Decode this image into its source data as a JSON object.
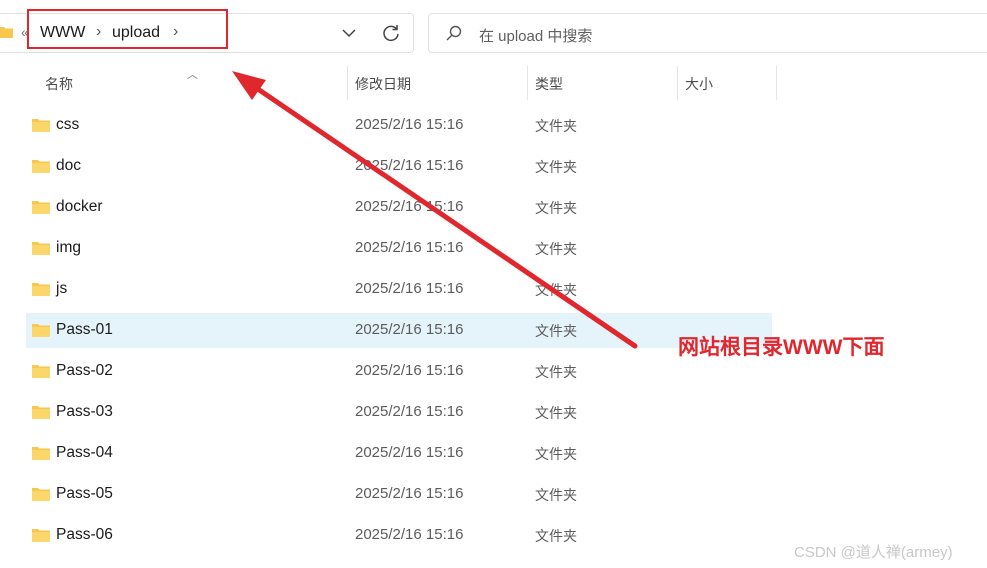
{
  "address_bar": {
    "overflow_glyph": "«",
    "crumbs": [
      "WWW",
      "upload"
    ],
    "separator": "›"
  },
  "search": {
    "placeholder": "在 upload 中搜索"
  },
  "columns": {
    "name": "名称",
    "modified": "修改日期",
    "type": "类型",
    "size": "大小"
  },
  "files": [
    {
      "name": "css",
      "modified": "2025/2/16 15:16",
      "type": "文件夹"
    },
    {
      "name": "doc",
      "modified": "2025/2/16 15:16",
      "type": "文件夹"
    },
    {
      "name": "docker",
      "modified": "2025/2/16 15:16",
      "type": "文件夹"
    },
    {
      "name": "img",
      "modified": "2025/2/16 15:16",
      "type": "文件夹"
    },
    {
      "name": "js",
      "modified": "2025/2/16 15:16",
      "type": "文件夹"
    },
    {
      "name": "Pass-01",
      "modified": "2025/2/16 15:16",
      "type": "文件夹",
      "selected": true
    },
    {
      "name": "Pass-02",
      "modified": "2025/2/16 15:16",
      "type": "文件夹"
    },
    {
      "name": "Pass-03",
      "modified": "2025/2/16 15:16",
      "type": "文件夹"
    },
    {
      "name": "Pass-04",
      "modified": "2025/2/16 15:16",
      "type": "文件夹"
    },
    {
      "name": "Pass-05",
      "modified": "2025/2/16 15:16",
      "type": "文件夹"
    },
    {
      "name": "Pass-06",
      "modified": "2025/2/16 15:16",
      "type": "文件夹"
    }
  ],
  "annotation": {
    "text": "网站根目录WWW下面",
    "color": "#e1272e"
  },
  "watermark": "CSDN @道人禅(armey)",
  "colors": {
    "selection": "#e5f3fb",
    "folder": "#f8c74d",
    "accent_red": "#e1272e"
  }
}
